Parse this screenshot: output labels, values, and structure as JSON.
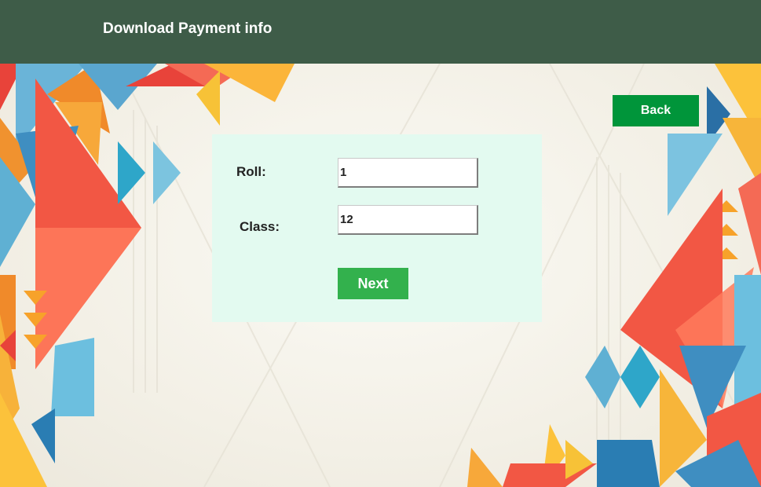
{
  "header": {
    "title": "Download Payment info"
  },
  "nav": {
    "back_label": "Back"
  },
  "form": {
    "roll_label": "Roll:",
    "roll_value": "1",
    "class_label": "Class:",
    "class_value": "12",
    "next_label": "Next"
  },
  "colors": {
    "header_bg": "#3e5c48",
    "back_button": "#00953a",
    "next_button": "#33b14d",
    "panel_bg": "#e3faf0"
  }
}
